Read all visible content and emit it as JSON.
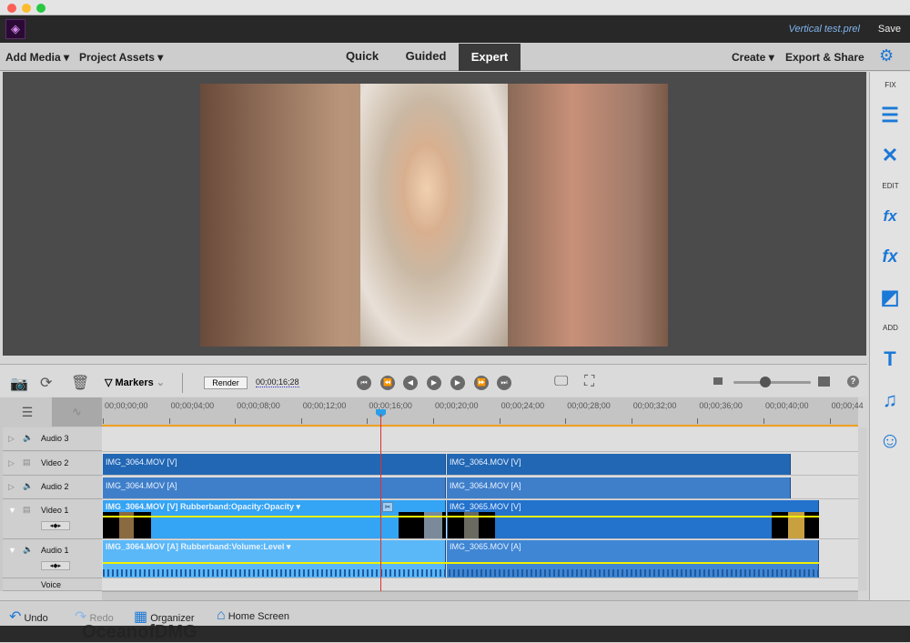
{
  "window": {
    "project_name": "Vertical test.prel",
    "save_label": "Save"
  },
  "toolbar": {
    "add_media": "Add Media",
    "project_assets": "Project Assets",
    "modes": [
      "Quick",
      "Guided",
      "Expert"
    ],
    "active_mode": "Expert",
    "create": "Create",
    "export_share": "Export & Share"
  },
  "right_panel": {
    "fix_label": "FIX",
    "edit_label": "EDIT",
    "add_label": "ADD"
  },
  "timeline_toolbar": {
    "markers_label": "Markers",
    "render_label": "Render",
    "current_time": "00;00;16;28",
    "zoom_level": 0.45
  },
  "ruler": {
    "ticks": [
      "00;00;00;00",
      "00;00;04;00",
      "00;00;08;00",
      "00;00;12;00",
      "00;00;16;00",
      "00;00;20;00",
      "00;00;24;00",
      "00;00;28;00",
      "00;00;32;00",
      "00;00;36;00",
      "00;00;40;00",
      "00;00;44"
    ]
  },
  "tracks": {
    "audio3": "Audio 3",
    "video2": "Video 2",
    "audio2": "Audio 2",
    "video1": "Video 1",
    "audio1": "Audio 1",
    "voice": "Voice"
  },
  "clips": {
    "v2a": "IMG_3064.MOV [V]",
    "v2b": "IMG_3064.MOV [V]",
    "a2a": "IMG_3064.MOV [A]",
    "a2b": "IMG_3064.MOV [A]",
    "v1a": "IMG_3064.MOV [V] Rubberband:Opacity:Opacity ▾",
    "v1b": "IMG_3065.MOV [V]",
    "a1a": "IMG_3064.MOV [A] Rubberband:Volume:Level ▾",
    "a1b": "IMG_3065.MOV [A]"
  },
  "bottom": {
    "undo": "Undo",
    "redo": "Redo",
    "organizer": "Organizer",
    "home_screen": "Home Screen"
  },
  "watermark": "OceanofDMG",
  "colors": {
    "accent": "#1a78d6",
    "playhead": "#e0302c",
    "clip_video": "#2267b4",
    "clip_selected": "#34a4f4"
  }
}
